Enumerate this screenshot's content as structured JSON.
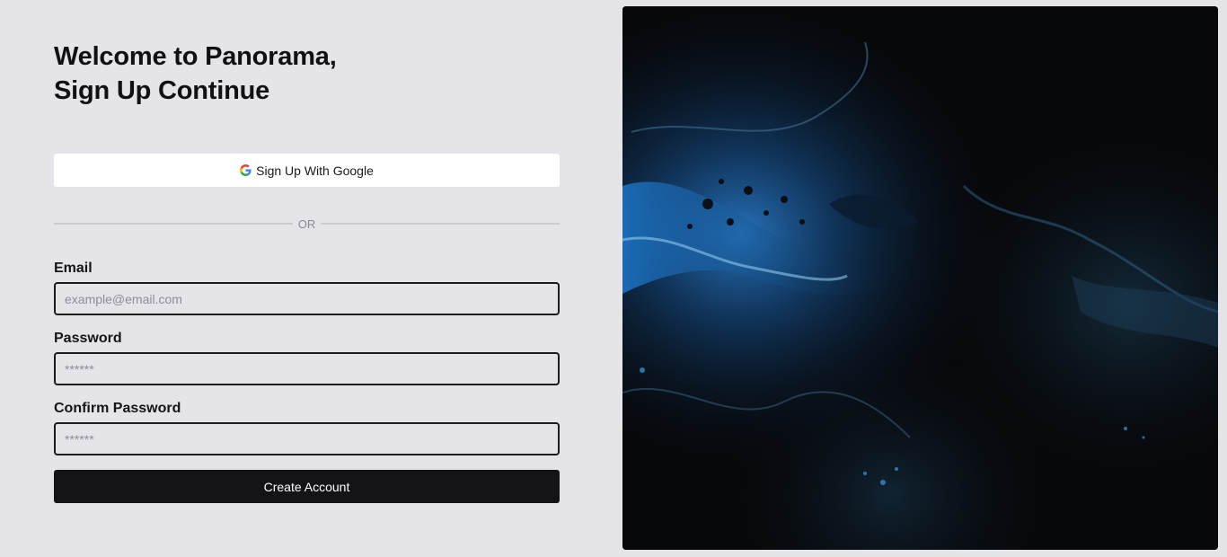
{
  "header": {
    "title_line1": "Welcome to Panorama,",
    "title_line2": "Sign Up Continue"
  },
  "google": {
    "label": "Sign Up With Google",
    "icon": "google-g-icon"
  },
  "divider": {
    "text": "OR"
  },
  "form": {
    "email_label": "Email",
    "email_placeholder": "example@email.com",
    "password_label": "Password",
    "password_placeholder": "******",
    "confirm_label": "Confirm Password",
    "confirm_placeholder": "******",
    "submit_label": "Create Account"
  },
  "colors": {
    "background": "#e5e4e9",
    "primary_button": "#141417",
    "input_border": "#1c1c20",
    "art_accent": "#1f7fd8"
  }
}
